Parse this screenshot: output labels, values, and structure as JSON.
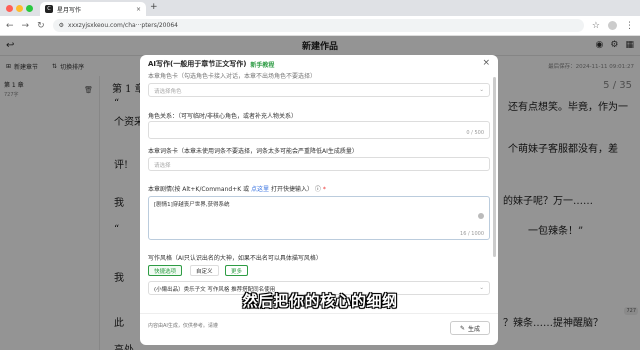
{
  "browser": {
    "tab_title": "星月写作",
    "tab_icon": "C",
    "url": "xxxzyjsxkeou.com/cha···pters/20064",
    "colors": {
      "close": "#ff5f57",
      "min": "#febc2e",
      "max": "#28c840"
    }
  },
  "app": {
    "title": "新建作品",
    "toolbar": {
      "new_chapter": "新建章节",
      "sort_toggle": "切换排序"
    },
    "saved_time": "最后保存：2024-11-11 09:01:27",
    "sidebar": {
      "chapter_title": "第 1 章",
      "chapter_count": "727字"
    },
    "editor": {
      "chapter_heading": "第 1 章",
      "pager": "5 / 35",
      "lines": [
        "“",
        "个资采",
        "评!",
        "我",
        "“",
        "我",
        "此",
        "高处"
      ],
      "right_fragments": [
        "还有点想笑。毕竟，作为一",
        "个萌妹子客服都没有，差",
        "的妹子呢？万一……",
        "一包辣条！”",
        "？辣条……提神醒脑？"
      ],
      "word_count_badge": "727"
    }
  },
  "modal": {
    "title": "AI写作(一般用于章节正文写作)",
    "tutorial_link": "新手教程",
    "role_label_partial": "本章角色卡（勾选角色卡接入对话，本章不出场角色不要选择）",
    "role_placeholder": "请选择角色",
    "relation_label": "角色关系：（可写临时/非核心角色，或者补充人物关系）",
    "relation_counter": "0 / 500",
    "glossary_label": "本章词条卡（本章未使用词条不要选择，词条太多可能会严重降低AI生成质量）",
    "glossary_placeholder": "请选择",
    "plot_label_prefix": "本章剧情(按 Alt+K/Command+K 或",
    "plot_label_link": "点这里",
    "plot_label_suffix": "打开快捷输入）",
    "plot_value": "[剧情1]穿越丧尸世界,获得系统",
    "plot_counter": "16 / 1000",
    "style_label": "写作风格（AI只认识出名的大神，如果不出名可以具体描写风格）",
    "style_tabs": [
      "快捷选项",
      "自定义",
      "更多"
    ],
    "style_value": "(小懒出品）类乐子文 写作风格 推荐搭配同名使用",
    "footer_note": "内容由AI生成，仅供参考。请遵",
    "generate_label": "生成"
  },
  "subtitle": "然后把你的核心的细纲"
}
